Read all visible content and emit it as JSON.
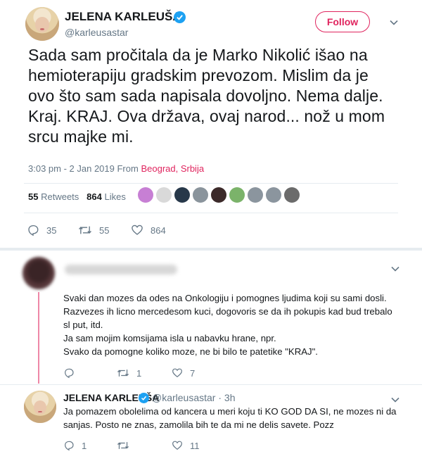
{
  "tweet": {
    "author_name": "JELENA KARLEUŠA",
    "handle": "@karleusastar",
    "follow_label": "Follow",
    "text": "Sada sam pročitala da je Marko Nikolić išao na hemioterapiju gradskim prevozom. Mislim da je ovo što sam sada napisala dovoljno. Nema dalje. Kraj. KRAJ. Ova država, ovaj narod... nož u mom srcu majke mi.",
    "time": "3:03 pm - 2 Jan 2019",
    "from_label": "From",
    "location": "Beograd, Srbija",
    "retweets_count": "55",
    "retweets_label": "Retweets",
    "likes_count": "864",
    "likes_label": "Likes",
    "actions": {
      "replies": "35",
      "retweets": "55",
      "likes": "864"
    },
    "likers": [
      "#c77fd4",
      "#d9d9d9",
      "#27384a",
      "#8a949c",
      "#3c2a2a",
      "#7bb36a",
      "#8b959e",
      "#8b959e",
      "#6b6b6b"
    ]
  },
  "reply1": {
    "lines": [
      "Svaki dan mozes da odes na Onkologiju i pomognes ljudima koji su sami dosli.",
      "Razvezes ih licno mercedesom kuci, dogovoris se da ih pokupis kad bud trebalo",
      "sl put, itd.",
      "Ja sam mojim komsijama isla u nabavku hrane, npr.",
      "Svako da pomogne koliko moze, ne bi bilo te patetike \"KRAJ\"."
    ],
    "actions": {
      "replies": "",
      "retweets": "1",
      "likes": "7"
    }
  },
  "reply2": {
    "author_name": "JELENA KARLEUŠA",
    "handle": "@karleusastar",
    "time": "· 3h",
    "lines": [
      "Ja pomazem obolelima od kancera u meri koju ti KO GOD DA SI, ne mozes ni da",
      "sanjas. Posto ne znas, zamolila bih te da mi ne delis savete. Pozz"
    ],
    "actions": {
      "replies": "1",
      "retweets": "",
      "likes": "11"
    }
  },
  "colors": {
    "accent": "#e0245e",
    "verified": "#1da1f2",
    "muted": "#657786",
    "text": "#14171a"
  }
}
